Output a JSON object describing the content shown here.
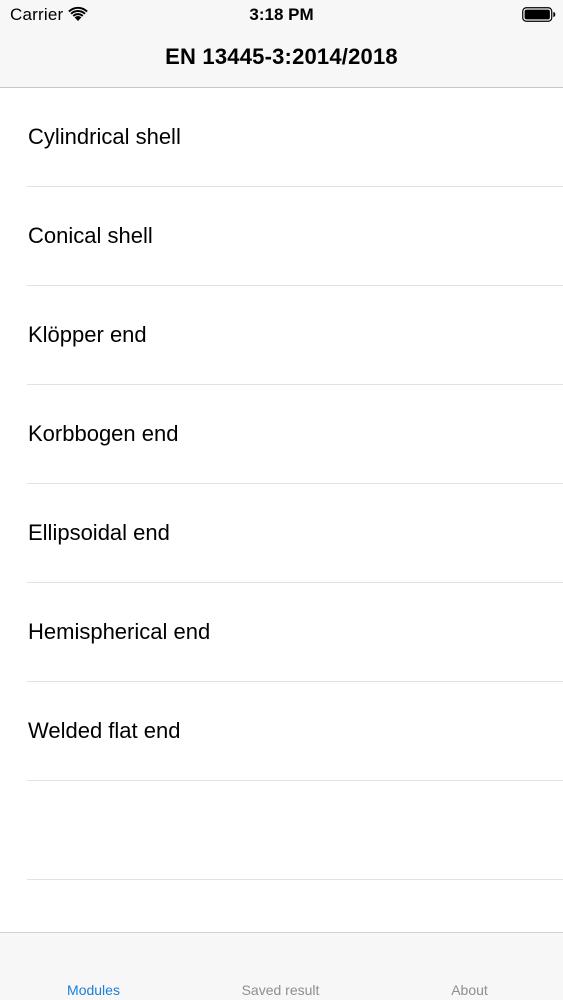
{
  "status_bar": {
    "carrier": "Carrier",
    "time": "3:18 PM",
    "wifi_icon": "wifi-icon",
    "battery_icon": "battery-icon"
  },
  "nav": {
    "title": "EN 13445-3:2014/2018"
  },
  "list": {
    "items": [
      {
        "label": "Cylindrical shell"
      },
      {
        "label": "Conical shell"
      },
      {
        "label": "Klöpper end"
      },
      {
        "label": "Korbbogen end"
      },
      {
        "label": "Ellipsoidal end"
      },
      {
        "label": "Hemispherical end"
      },
      {
        "label": "Welded flat end"
      },
      {
        "label": ""
      }
    ]
  },
  "tab_bar": {
    "tabs": [
      {
        "label": "Modules",
        "active": true
      },
      {
        "label": "Saved result",
        "active": false
      },
      {
        "label": "About",
        "active": false
      }
    ],
    "active_color": "#1a7fd8",
    "inactive_color": "#8e8e93"
  }
}
